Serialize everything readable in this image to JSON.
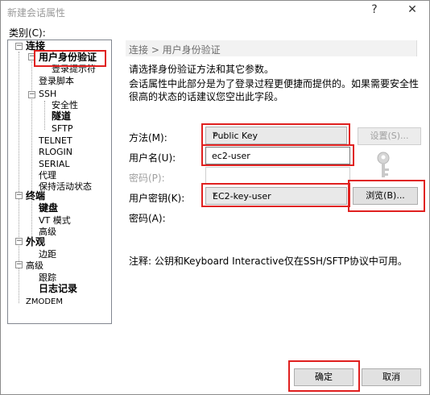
{
  "window": {
    "title": "新建会话属性",
    "help_glyph": "?",
    "close_glyph": "✕"
  },
  "category_label": "类别(C):",
  "tree": {
    "items": [
      {
        "label": "连接",
        "bold": true
      },
      {
        "label": "用户身份验证",
        "bold": true
      },
      {
        "label": "登录提示符",
        "bold": false
      },
      {
        "label": "登录脚本",
        "bold": false
      },
      {
        "label": "SSH",
        "bold": false
      },
      {
        "label": "安全性",
        "bold": false
      },
      {
        "label": "隧道",
        "bold": true
      },
      {
        "label": "SFTP",
        "bold": false
      },
      {
        "label": "TELNET",
        "bold": false
      },
      {
        "label": "RLOGIN",
        "bold": false
      },
      {
        "label": "SERIAL",
        "bold": false
      },
      {
        "label": "代理",
        "bold": false
      },
      {
        "label": "保持活动状态",
        "bold": false
      },
      {
        "label": "终端",
        "bold": true
      },
      {
        "label": "键盘",
        "bold": true
      },
      {
        "label": "VT 模式",
        "bold": false
      },
      {
        "label": "高级",
        "bold": false
      },
      {
        "label": "外观",
        "bold": true
      },
      {
        "label": "边距",
        "bold": false
      },
      {
        "label": "高级",
        "bold": false
      },
      {
        "label": "跟踪",
        "bold": false
      },
      {
        "label": "日志记录",
        "bold": true
      },
      {
        "label": "ZMODEM",
        "bold": false
      }
    ],
    "expand_glyph": "−"
  },
  "panel": {
    "breadcrumb": "连接 > 用户身份验证",
    "desc1": "请选择身份验证方法和其它参数。",
    "desc2": "会话属性中此部分是为了登录过程更便捷而提供的。如果需要安全性",
    "desc3": "很高的状态的话建议您空出此字段。",
    "method_label": "方法(M):",
    "method_value": "Public Key",
    "setup_button": "设置(S)...",
    "username_label": "用户名(U):",
    "username_value": "ec2-user",
    "password_label": "密码(P):",
    "password_value": "",
    "userkey_label": "用户密钥(K):",
    "userkey_value": "EC2-key-user",
    "browse_button": "浏览(B)...",
    "passphrase_label": "密码(A):",
    "note": "注释: 公钥和Keyboard Interactive仅在SSH/SFTP协议中可用。"
  },
  "footer": {
    "ok_button": "确定",
    "cancel_button": "取消"
  },
  "colors": {
    "highlight_border": "#e0201f"
  }
}
